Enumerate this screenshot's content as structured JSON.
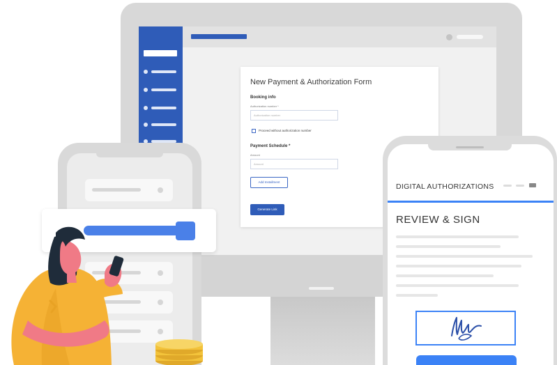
{
  "desktop_form": {
    "title": "New Payment & Authorization Form",
    "booking_info_label": "Booking info",
    "auth_number_label": "Authorization number *",
    "auth_number_placeholder": "Authorization number",
    "proceed_checkbox_label": "Proceed without authorization number",
    "payment_schedule_label": "Payment Schedule *",
    "amount_label": "Amount",
    "amount_placeholder": "Amount",
    "add_installment_label": "Add Installment",
    "generate_link_label": "Generate Link"
  },
  "mobile_signing": {
    "header_title": "DIGITAL AUTHORIZATIONS",
    "section_title": "REVIEW & SIGN"
  },
  "colors": {
    "brand_blue": "#2f5cb8",
    "accent_blue": "#3b82f6",
    "person_coat": "#f5b235",
    "person_skin": "#f07a86",
    "coin_gold": "#f3c33a"
  }
}
